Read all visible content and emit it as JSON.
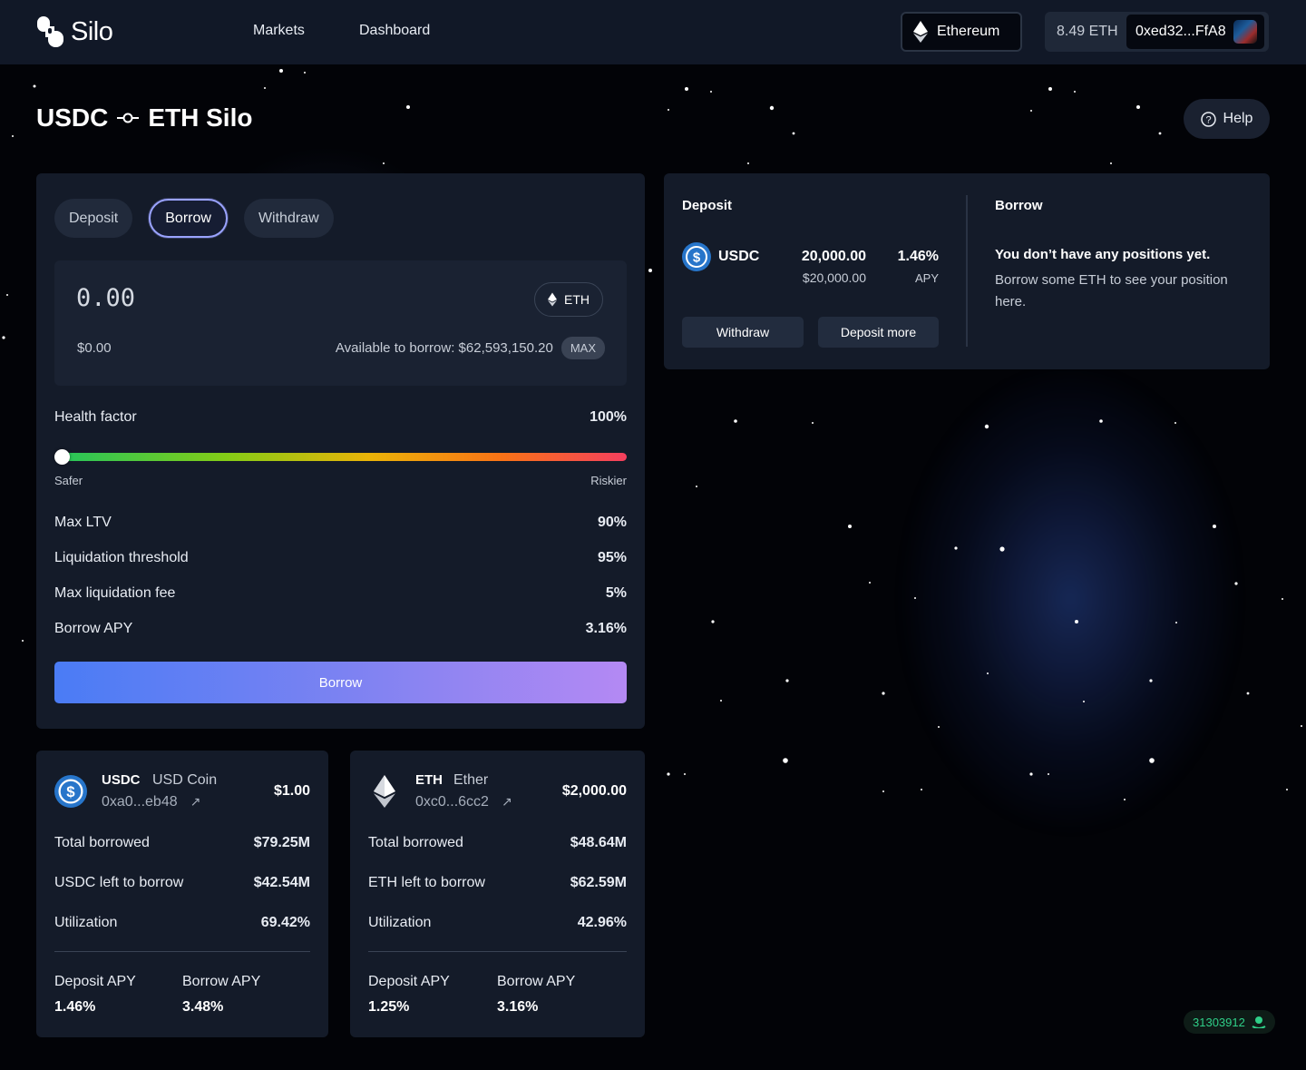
{
  "header": {
    "logo_text": "Silo",
    "nav": [
      "Markets",
      "Dashboard"
    ],
    "network": "Ethereum",
    "balance": "8.49 ETH",
    "address": "0xed32...FfA8"
  },
  "page": {
    "title_left": "USDC",
    "title_right": "ETH Silo",
    "help": "Help"
  },
  "form": {
    "tabs": [
      "Deposit",
      "Borrow",
      "Withdraw"
    ],
    "active_tab": "Borrow",
    "amount": "0.00",
    "token": "ETH",
    "usd_value": "$0.00",
    "available": "Available to borrow: $62,593,150.20",
    "max": "MAX",
    "health_label": "Health factor",
    "health_value": "100%",
    "health_fraction": 0,
    "safer": "Safer",
    "riskier": "Riskier",
    "stats": [
      {
        "label": "Max LTV",
        "value": "90%"
      },
      {
        "label": "Liquidation threshold",
        "value": "95%"
      },
      {
        "label": "Max liquidation fee",
        "value": "5%"
      },
      {
        "label": "Borrow APY",
        "value": "3.16%"
      }
    ],
    "submit": "Borrow"
  },
  "positions": {
    "deposit_title": "Deposit",
    "deposit_token": "USDC",
    "deposit_amount": "20,000.00",
    "deposit_usd": "$20,000.00",
    "deposit_apy": "1.46%",
    "apy_label": "APY",
    "withdraw_btn": "Withdraw",
    "deposit_more_btn": "Deposit more",
    "borrow_title": "Borrow",
    "empty_title": "You don’t have any positions yet.",
    "empty_text": "Borrow some ETH to see your position here."
  },
  "assets": [
    {
      "symbol": "USDC",
      "name": "USD Coin",
      "address": "0xa0...eb48",
      "price": "$1.00",
      "rows": [
        {
          "label": "Total borrowed",
          "value": "$79.25M"
        },
        {
          "label": "USDC left to borrow",
          "value": "$42.54M"
        },
        {
          "label": "Utilization",
          "value": "69.42%"
        }
      ],
      "deposit_apy_label": "Deposit APY",
      "deposit_apy": "1.46%",
      "borrow_apy_label": "Borrow APY",
      "borrow_apy": "3.48%"
    },
    {
      "symbol": "ETH",
      "name": "Ether",
      "address": "0xc0...6cc2",
      "price": "$2,000.00",
      "rows": [
        {
          "label": "Total borrowed",
          "value": "$48.64M"
        },
        {
          "label": "ETH left to borrow",
          "value": "$62.59M"
        },
        {
          "label": "Utilization",
          "value": "42.96%"
        }
      ],
      "deposit_apy_label": "Deposit APY",
      "deposit_apy": "1.25%",
      "borrow_apy_label": "Borrow APY",
      "borrow_apy": "3.16%"
    }
  ],
  "block_number": "31303912",
  "colors": {
    "accent": "#9aa3ff",
    "panel": "#141b29",
    "block_green": "#2fcf88"
  }
}
